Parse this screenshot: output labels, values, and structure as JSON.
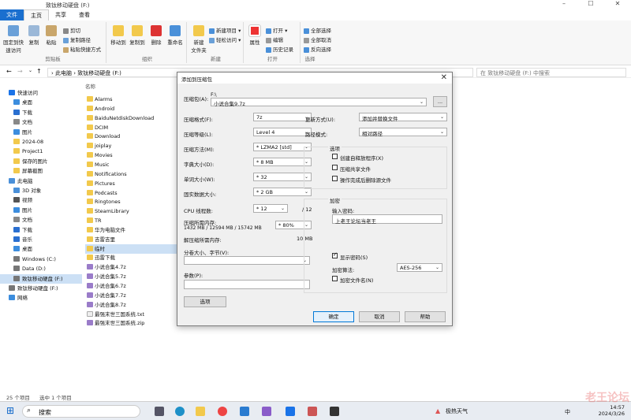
{
  "window": {
    "title": "致钛移动硬盘 (F:)",
    "controls": [
      "–",
      "☐",
      "✕"
    ]
  },
  "ribbon_tabs": [
    {
      "label": "文件",
      "active": true
    },
    {
      "label": "主页",
      "selected": true
    },
    {
      "label": "共享"
    },
    {
      "label": "查看"
    }
  ],
  "ribbon": {
    "clipboard": {
      "label": "剪贴板",
      "pin": "固定到快\n速访问",
      "copy": "复制",
      "paste": "粘贴",
      "cut": "剪切",
      "copy_path": "复制路径",
      "paste_shortcut": "粘贴快捷方式"
    },
    "organize": {
      "label": "组织",
      "move_to": "移动到",
      "copy_to": "复制到",
      "delete": "删除",
      "rename": "重命名"
    },
    "new": {
      "label": "新建",
      "new_folder": "新建\n文件夹",
      "new_item": "新建项目 ▾",
      "easy_access": "轻松访问 ▾"
    },
    "open": {
      "label": "打开",
      "properties": "属性",
      "open": "打开 ▾",
      "edit": "编辑",
      "history": "历史记录"
    },
    "select": {
      "label": "选择",
      "select_all": "全部选择",
      "select_none": "全部取消",
      "invert": "反向选择"
    }
  },
  "address": {
    "path": "› 此电脑 › 致钛移动硬盘 (F:)",
    "search_placeholder": "在 致钛移动硬盘 (F:) 中搜索"
  },
  "nav": [
    {
      "label": "快速访问",
      "color": "#1a73e8",
      "indent": 0
    },
    {
      "label": "桌面",
      "color": "#3c8dde",
      "indent": 1
    },
    {
      "label": "下载",
      "color": "#2a6fd0",
      "indent": 1
    },
    {
      "label": "文档",
      "color": "#888888",
      "indent": 1
    },
    {
      "label": "图片",
      "color": "#3c8dde",
      "indent": 1
    },
    {
      "label": "2024-08",
      "color": "#f2c94c",
      "indent": 1
    },
    {
      "label": "Project1",
      "color": "#f2c94c",
      "indent": 1
    },
    {
      "label": "保存的图片",
      "color": "#f2c94c",
      "indent": 1
    },
    {
      "label": "屏幕截图",
      "color": "#f2c94c",
      "indent": 1
    },
    {
      "label": "此电脑",
      "color": "#4a90d9",
      "indent": 0
    },
    {
      "label": "3D 对象",
      "color": "#4a90d9",
      "indent": 1
    },
    {
      "label": "视频",
      "color": "#555555",
      "indent": 1
    },
    {
      "label": "图片",
      "color": "#3c8dde",
      "indent": 1
    },
    {
      "label": "文档",
      "color": "#888888",
      "indent": 1
    },
    {
      "label": "下载",
      "color": "#2a6fd0",
      "indent": 1
    },
    {
      "label": "音乐",
      "color": "#2a6fd0",
      "indent": 1
    },
    {
      "label": "桌面",
      "color": "#3c8dde",
      "indent": 1
    },
    {
      "label": "Windows (C:)",
      "color": "#777777",
      "indent": 1
    },
    {
      "label": "Data (D:)",
      "color": "#777777",
      "indent": 1
    },
    {
      "label": "致钛移动硬盘 (F:)",
      "color": "#777777",
      "indent": 1,
      "selected": true
    },
    {
      "label": "致钛移动硬盘 (F:)",
      "color": "#777777",
      "indent": 0
    },
    {
      "label": "网络",
      "color": "#3c8dde",
      "indent": 0
    }
  ],
  "files": {
    "column": "名称",
    "items": [
      {
        "name": "Alarms",
        "type": "folder"
      },
      {
        "name": "Android",
        "type": "folder"
      },
      {
        "name": "BaiduNetdiskDownload",
        "type": "folder"
      },
      {
        "name": "DCIM",
        "type": "folder"
      },
      {
        "name": "Download",
        "type": "folder"
      },
      {
        "name": "joiplay",
        "type": "folder"
      },
      {
        "name": "Movies",
        "type": "folder"
      },
      {
        "name": "Music",
        "type": "folder"
      },
      {
        "name": "Notifications",
        "type": "folder"
      },
      {
        "name": "Pictures",
        "type": "folder"
      },
      {
        "name": "Podcasts",
        "type": "folder"
      },
      {
        "name": "Ringtones",
        "type": "folder"
      },
      {
        "name": "SteamLibrary",
        "type": "folder"
      },
      {
        "name": "TR",
        "type": "folder"
      },
      {
        "name": "华为电脑文件",
        "type": "folder"
      },
      {
        "name": "吉雷吉里",
        "type": "folder"
      },
      {
        "name": "临时",
        "type": "folder",
        "selected": true
      },
      {
        "name": "迅雷下载",
        "type": "folder"
      },
      {
        "name": "小说合集4.7z",
        "type": "zip"
      },
      {
        "name": "小说合集5.7z",
        "type": "zip"
      },
      {
        "name": "小说合集6.7z",
        "type": "zip"
      },
      {
        "name": "小说合集7.7z",
        "type": "zip"
      },
      {
        "name": "小说合集8.7z",
        "type": "zip"
      },
      {
        "name": "最强末世三国系统.txt",
        "type": "txt"
      },
      {
        "name": "最强末世三国系统.zip",
        "type": "zip"
      }
    ]
  },
  "status": {
    "count": "25 个项目",
    "selected": "选中 1 个项目"
  },
  "dialog": {
    "title": "添加到压缩包",
    "close": "✕",
    "archive_label": "压缩包(A):",
    "archive_dir": "F:\\",
    "archive_name": "小说合集9.7z",
    "browse": "...",
    "format_label": "压缩格式(F):",
    "format": "7z",
    "level_label": "压缩等级(L):",
    "level": "Level 4",
    "method_label": "压缩方法(M):",
    "method": "* LZMA2 [std]",
    "dict_label": "字典大小(D):",
    "dict": "* 8 MB",
    "word_label": "单词大小(W):",
    "word": "* 32",
    "solid_label": "固实数据大小:",
    "solid": "* 2 GB",
    "cpu_label": "CPU 线程数:",
    "cpu": "* 12",
    "cpu_total": "/ 12",
    "mem_comp_label": "压缩所需内存:",
    "mem_comp": "1432 MB / 12594 MB / 15742 MB",
    "mem_pct": "* 80%",
    "mem_decomp_label": "解压缩所需内存:",
    "mem_decomp": "10 MB",
    "split_label": "分卷大小、字节(V):",
    "params_label": "参数(P):",
    "options_btn": "选项",
    "update_label": "更新方式(U):",
    "update": "添加并替换文件",
    "path_label": "路径模式:",
    "path": "相对路径",
    "opt_group": "选项",
    "opt_sfx": "创建自释放程序(X)",
    "opt_shared": "压缩共享文件",
    "opt_delete": "操作完成后删除源文件",
    "enc_group": "加密",
    "pwd_label": "输入密码:",
    "pwd_value": "上老王论坛当老王",
    "show_pwd": "显示密码(S)",
    "enc_method_label": "加密算法:",
    "enc_method": "AES-256",
    "enc_names": "加密文件名(N)",
    "ok": "确定",
    "cancel": "取消",
    "help": "帮助"
  },
  "taskbar": {
    "search": "搜索",
    "weather": "极热天气",
    "time": "14:57",
    "date": "2024/3/26",
    "lang": "中"
  },
  "watermark": "老王论坛"
}
